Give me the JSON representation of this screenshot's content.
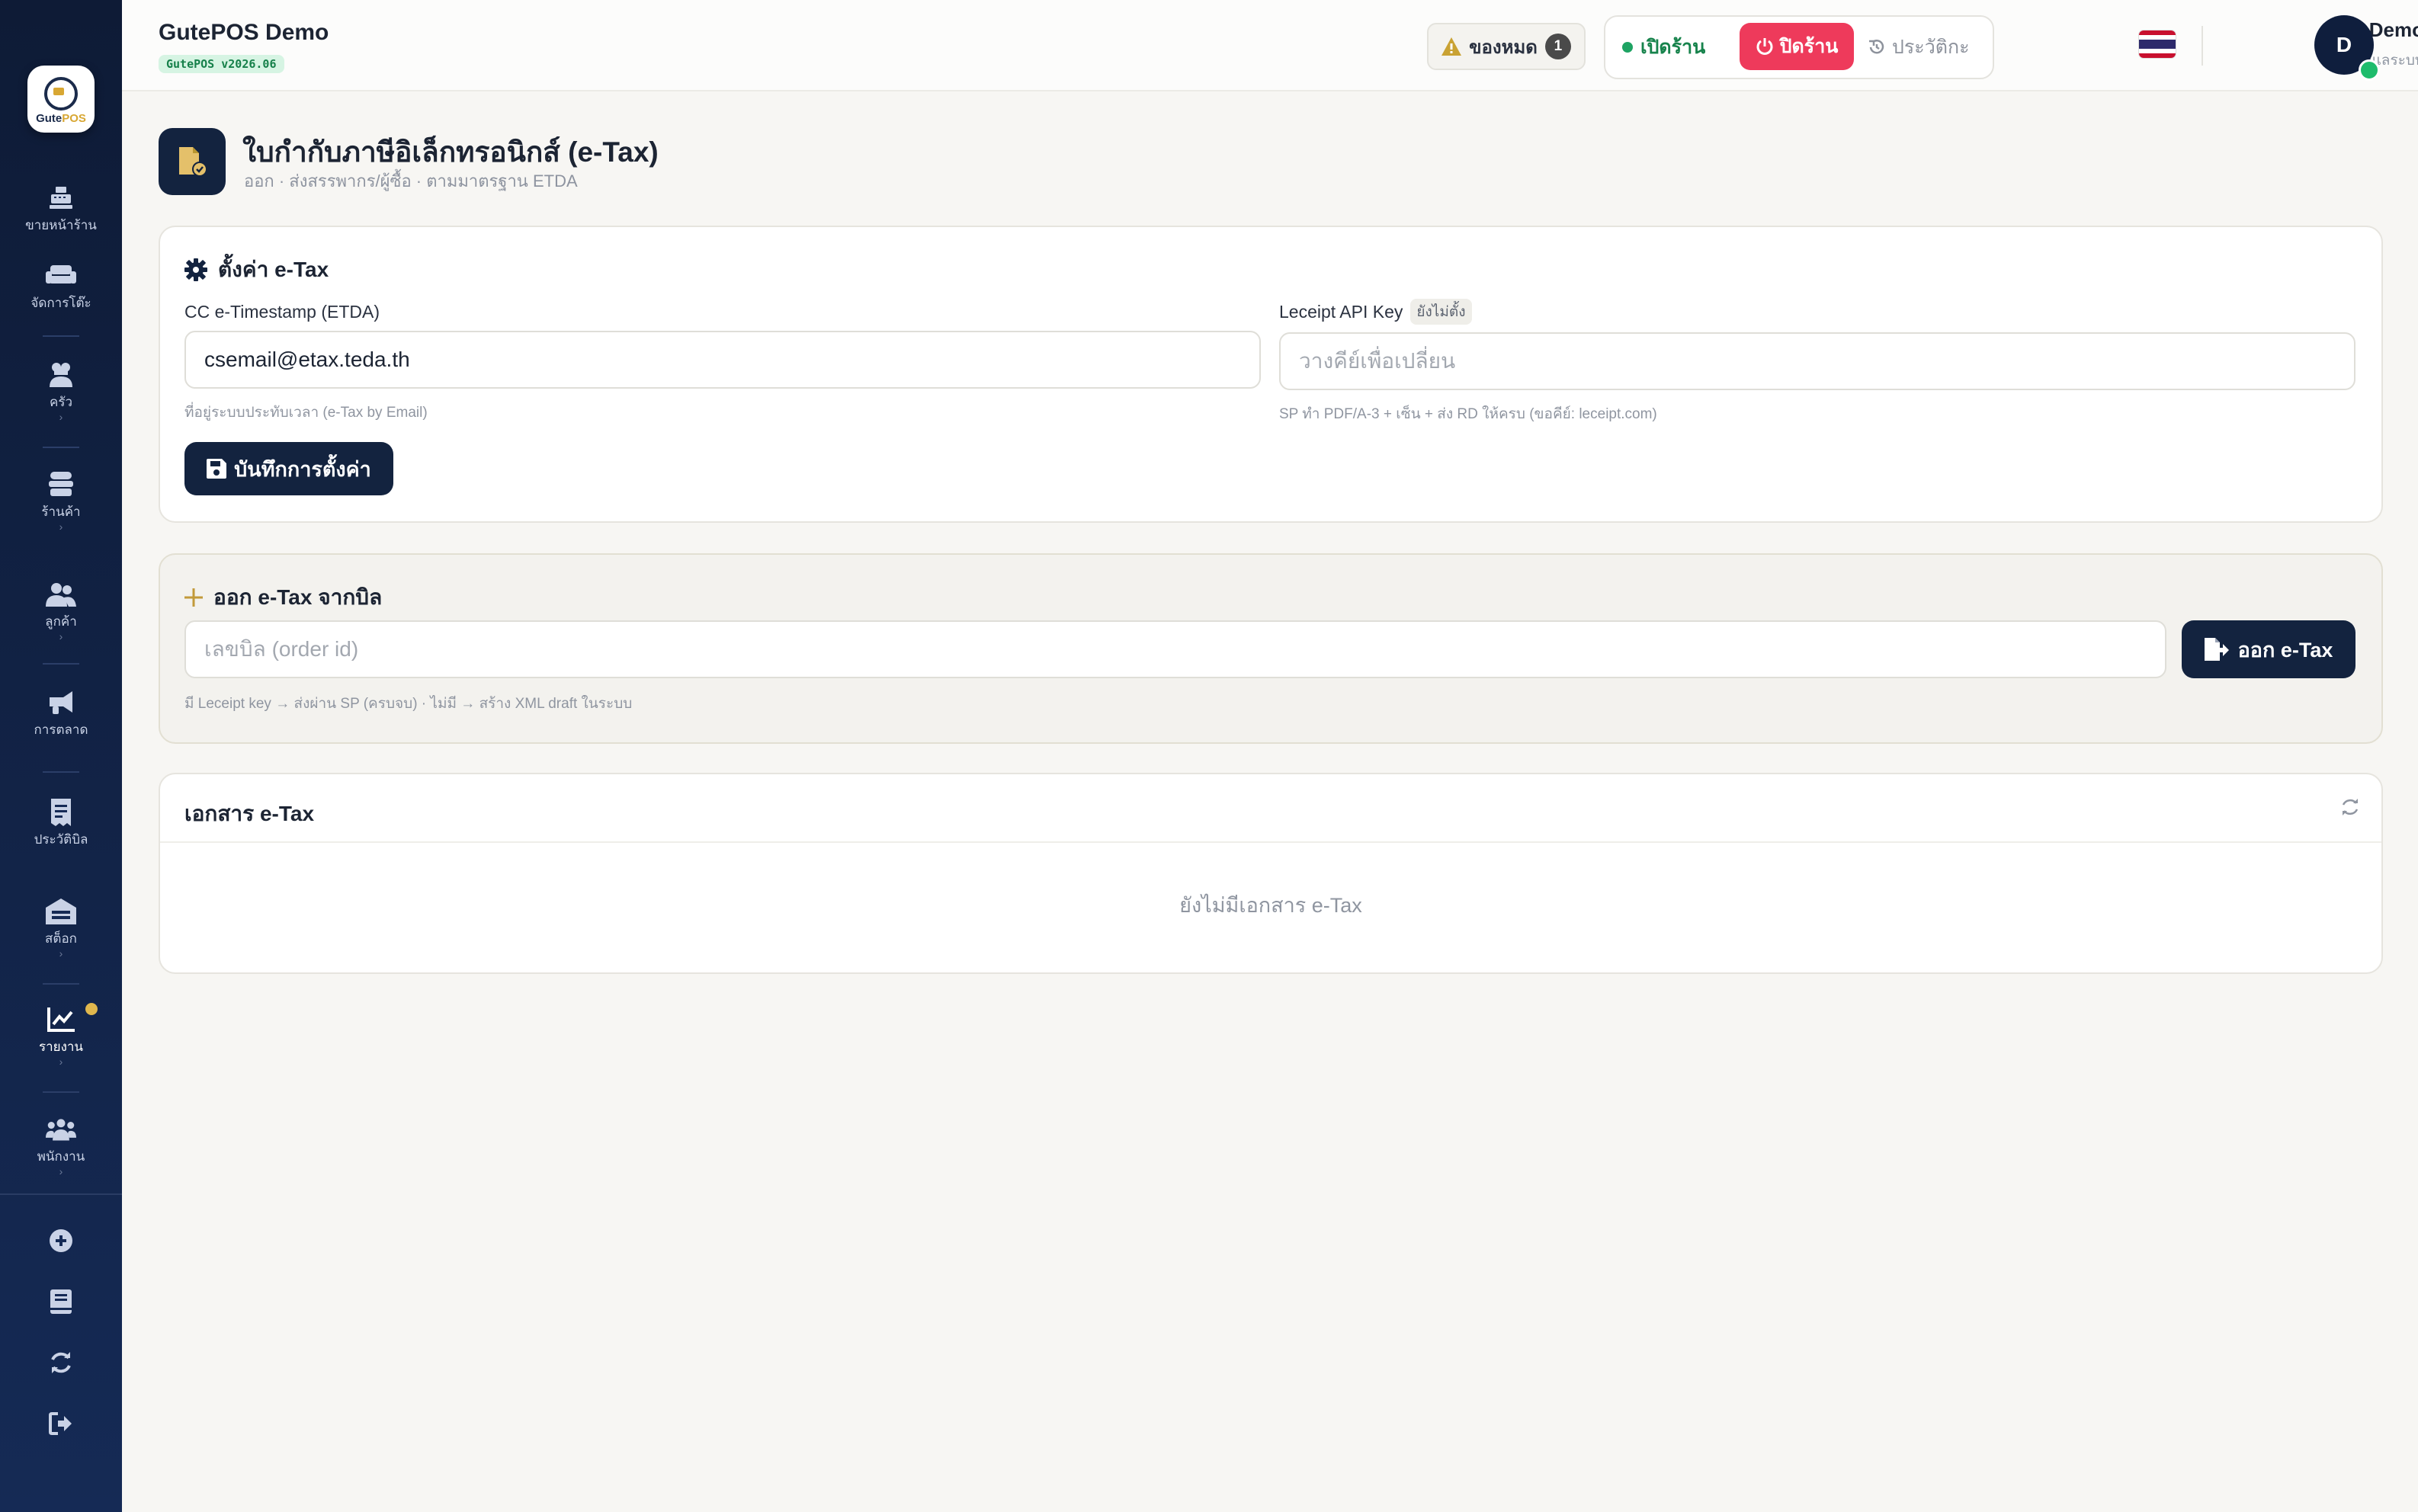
{
  "app": {
    "title": "GutePOS Demo",
    "version": "GutePOS v2026.06",
    "logo_text_a": "Gute",
    "logo_text_b": "POS"
  },
  "sidebar": {
    "items": [
      {
        "label": "ขายหน้าร้าน",
        "icon": "cash-register-icon"
      },
      {
        "label": "จัดการโต๊ะ",
        "icon": "couch-icon"
      },
      {
        "label": "ครัว",
        "icon": "chef-icon"
      },
      {
        "label": "ร้านค้า",
        "icon": "store-icon"
      },
      {
        "label": "ลูกค้า",
        "icon": "users-icon"
      },
      {
        "label": "การตลาด",
        "icon": "megaphone-icon"
      },
      {
        "label": "ประวัติบิล",
        "icon": "receipt-icon"
      },
      {
        "label": "สต็อก",
        "icon": "warehouse-icon"
      },
      {
        "label": "รายงาน",
        "icon": "chart-line-icon",
        "active": true
      },
      {
        "label": "พนักงาน",
        "icon": "staff-icon"
      }
    ],
    "tools": [
      "plus-circle-icon",
      "book-icon",
      "sync-icon",
      "logout-icon"
    ]
  },
  "header": {
    "stock_out_label": "ของหมด",
    "stock_out_count": "1",
    "open_label": "เปิดร้าน",
    "close_label": "ปิดร้าน",
    "history_label": "ประวัติกะ",
    "user_name": "Demo",
    "user_role": "ผู้ดูแลระบบ",
    "avatar_initial": "D"
  },
  "page": {
    "title": "ใบกำกับภาษีอิเล็กทรอนิกส์ (e-Tax)",
    "subtitle": "ออก · ส่งสรรพากร/ผู้ซื้อ · ตามมาตรฐาน ETDA"
  },
  "settings": {
    "title": "ตั้งค่า e-Tax",
    "cc_label": "CC e-Timestamp (ETDA)",
    "cc_value": "csemail@etax.teda.th",
    "cc_hint": "ที่อยู่ระบบประทับเวลา (e-Tax by Email)",
    "api_label": "Leceipt API Key",
    "api_status": "ยังไม่ตั้ง",
    "api_placeholder": "วางคีย์เพื่อเปลี่ยน",
    "api_hint": "SP ทำ PDF/A-3 + เซ็น + ส่ง RD ให้ครบ (ขอคีย์: leceipt.com)",
    "save_label": "บันทึกการตั้งค่า"
  },
  "issue": {
    "title": "ออก e-Tax จากบิล",
    "placeholder": "เลขบิล (order id)",
    "button_label": "ออก e-Tax",
    "hint": "มี Leceipt key → ส่งผ่าน SP (ครบจบ) · ไม่มี → สร้าง XML draft ในระบบ"
  },
  "documents": {
    "title": "เอกสาร e-Tax",
    "empty_text": "ยังไม่มีเอกสาร e-Tax"
  },
  "colors": {
    "accent_navy": "#13233f",
    "danger": "#ee3a5b",
    "success": "#1ea363",
    "gold": "#d8a733"
  }
}
